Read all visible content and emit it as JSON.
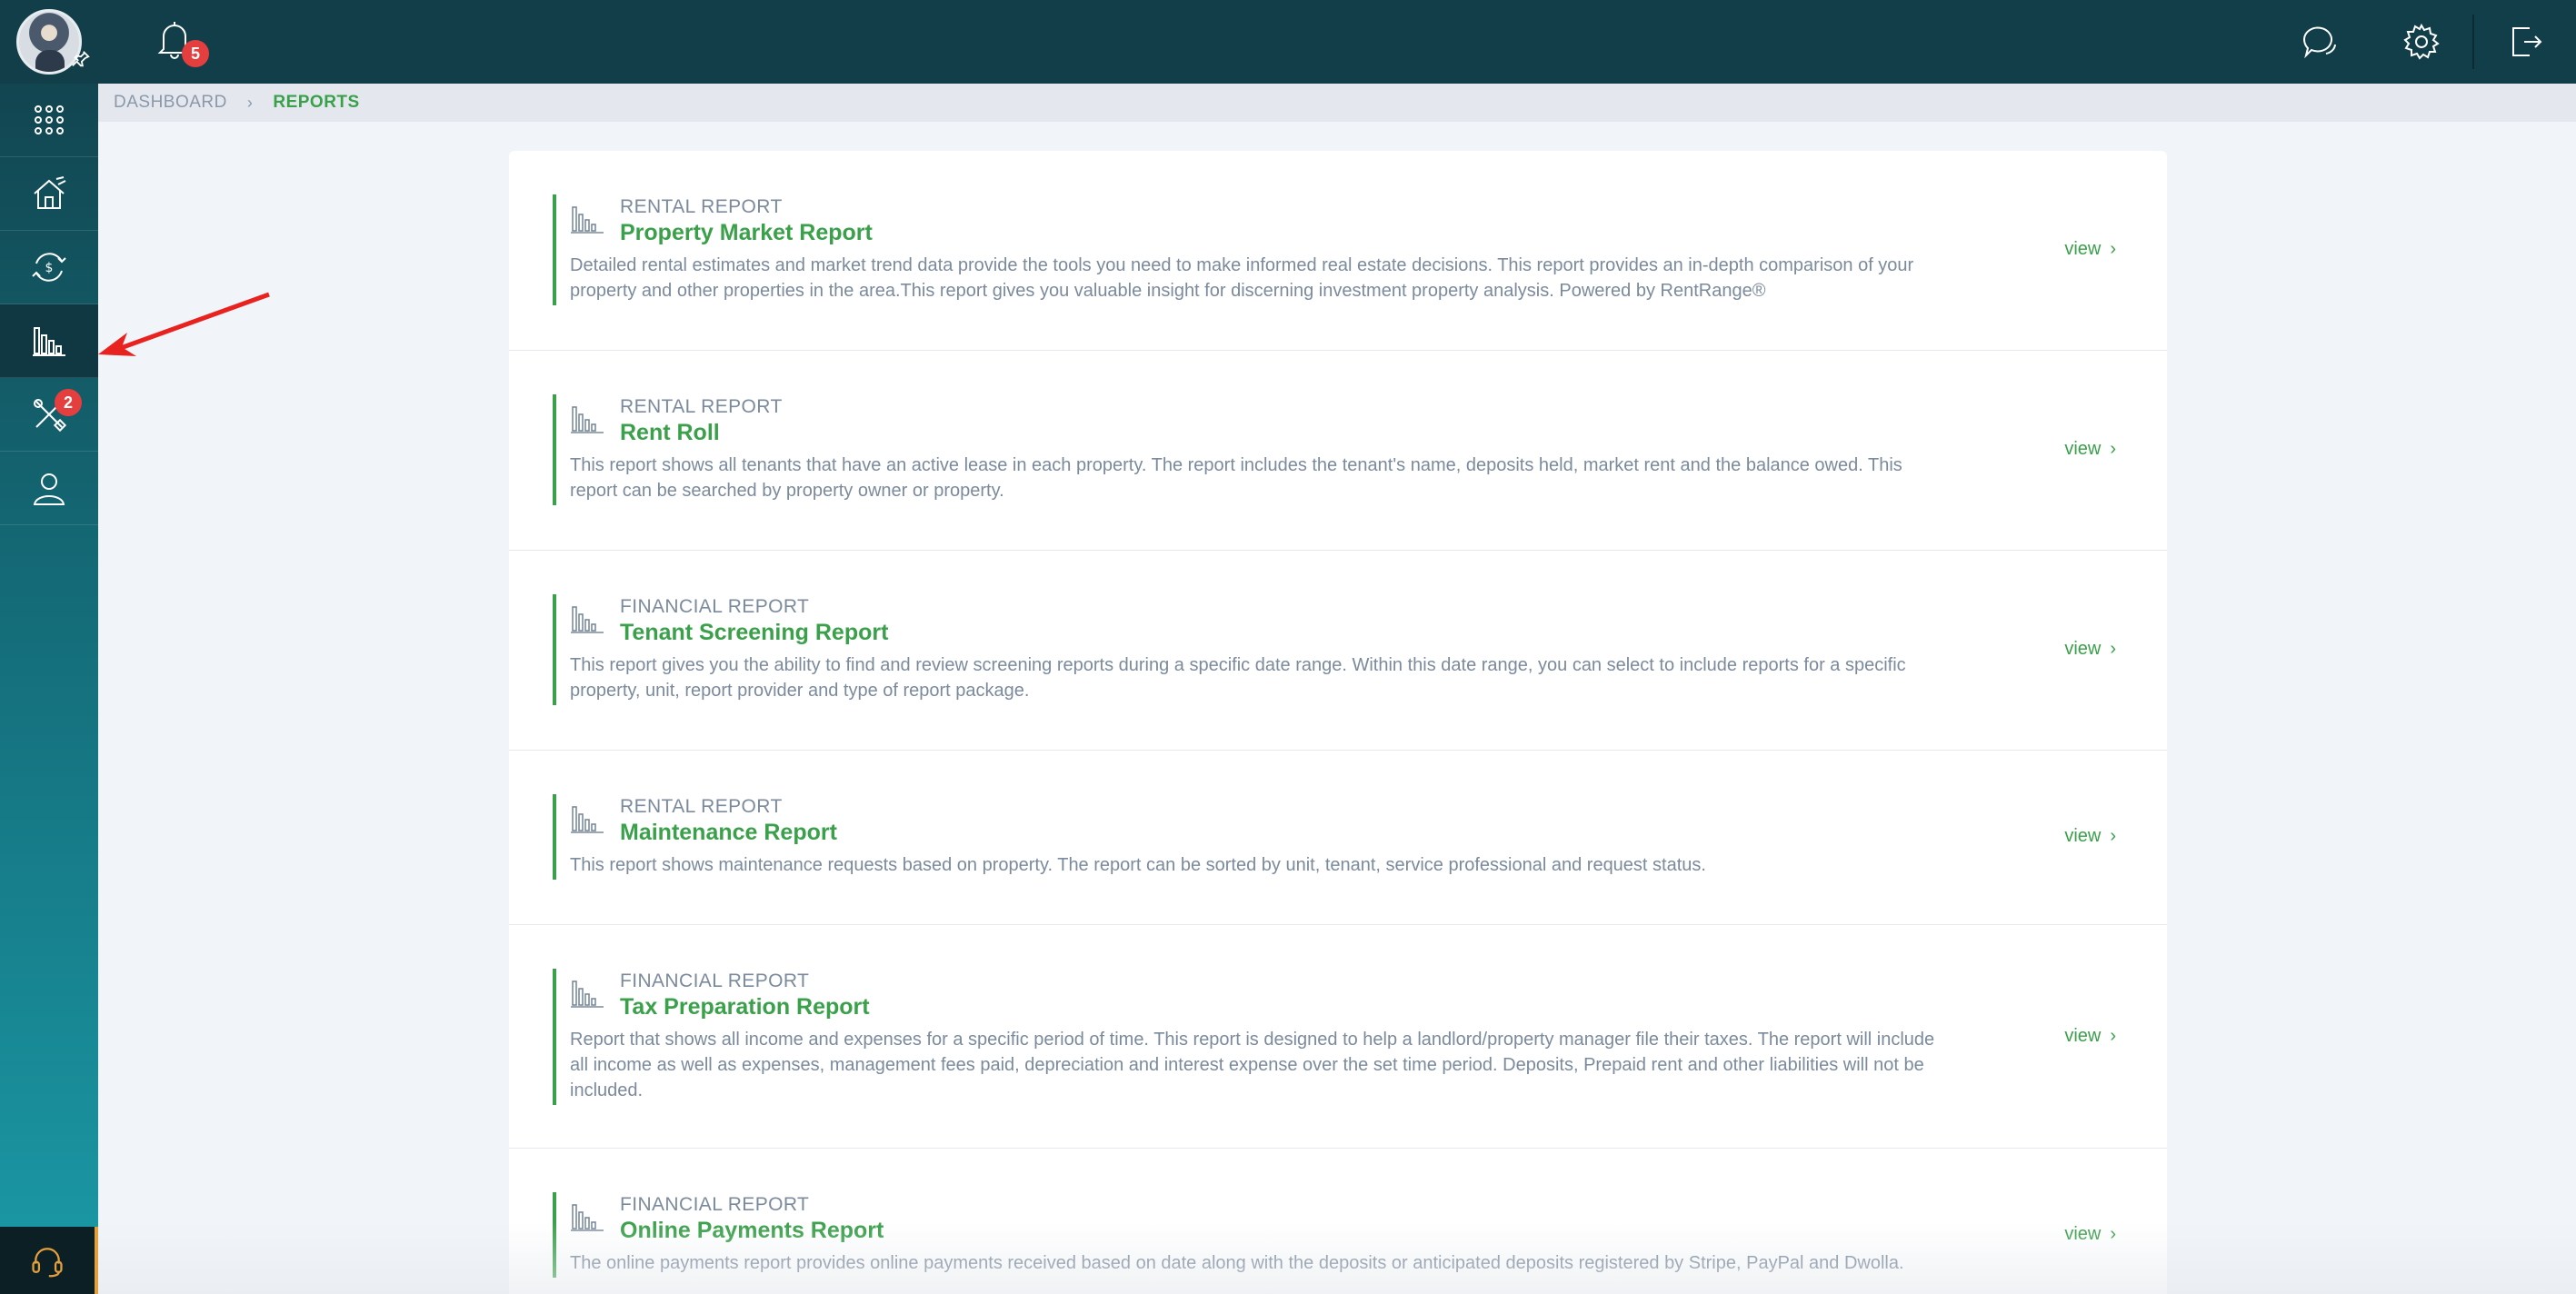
{
  "header": {
    "notifications_count": "5",
    "icons": [
      "chat-icon",
      "gear-icon",
      "logout-icon"
    ]
  },
  "sidebar": {
    "items": [
      {
        "name": "apps-grid",
        "icon": "grid-icon"
      },
      {
        "name": "properties",
        "icon": "house-icon"
      },
      {
        "name": "payments",
        "icon": "money-exchange-icon"
      },
      {
        "name": "reports",
        "icon": "bar-chart-icon",
        "active": true
      },
      {
        "name": "maintenance",
        "icon": "tools-icon",
        "badge": "2"
      },
      {
        "name": "contacts",
        "icon": "user-icon"
      }
    ],
    "support_icon": "headset-icon"
  },
  "breadcrumb": {
    "root": "DASHBOARD",
    "current": "REPORTS"
  },
  "reports": [
    {
      "category": "RENTAL REPORT",
      "title": "Property Market Report",
      "desc_lines": [
        "Detailed rental estimates and market trend data provide the tools you need to make informed real estate decisions. This report provides an in-depth comparison of your",
        "property and other properties in the area.This report gives you valuable insight for discerning investment property analysis. Powered by RentRange®"
      ],
      "view": "view"
    },
    {
      "category": "RENTAL REPORT",
      "title": "Rent Roll",
      "desc_lines": [
        "This report shows all tenants that have an active lease in each property. The report includes the tenant's name, deposits held, market rent and the balance owed. This",
        "report can be searched by property owner or property."
      ],
      "view": "view"
    },
    {
      "category": "FINANCIAL REPORT",
      "title": "Tenant Screening Report",
      "desc_lines": [
        "This report gives you the ability to find and review screening reports during a specific date range. Within this date range, you can select to include reports for a specific",
        "property, unit, report provider and type of report package."
      ],
      "view": "view"
    },
    {
      "category": "RENTAL REPORT",
      "title": "Maintenance Report",
      "desc_lines": [
        "This report shows maintenance requests based on property. The report can be sorted by unit, tenant, service professional and request status."
      ],
      "view": "view"
    },
    {
      "category": "FINANCIAL REPORT",
      "title": "Tax Preparation Report",
      "desc_lines": [
        "Report that shows all income and expenses for a specific period of time. This report is designed to help a landlord/property manager file their taxes. The report will include",
        "all income as well as expenses, management fees paid, depreciation and interest expense over the set time period. Deposits, Prepaid rent and other liabilities will not be",
        "included."
      ],
      "view": "view"
    },
    {
      "category": "FINANCIAL REPORT",
      "title": "Online Payments Report",
      "desc_lines": [
        "The online payments report provides online payments received based on date along with the deposits or anticipated deposits registered by Stripe, PayPal and Dwolla."
      ],
      "view": "view"
    }
  ],
  "colors": {
    "sidebar_top": "#123f4a",
    "sidebar_bottom": "#1b9aa7",
    "accent": "#3aa04a",
    "badge": "#e53e3e",
    "annotation_arrow": "#e8231f"
  }
}
